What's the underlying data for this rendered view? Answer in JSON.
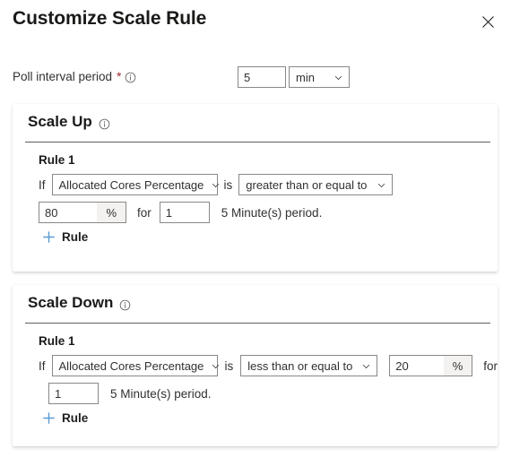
{
  "header": {
    "title": "Customize Scale Rule",
    "close_icon": "close-icon",
    "close_label": "Close"
  },
  "poll_interval": {
    "label": "Poll interval period",
    "required_marker": "*",
    "info_icon": "info-icon",
    "value": "5",
    "unit": "min",
    "unit_chevron_icon": "chevron-down-icon"
  },
  "sections": [
    {
      "id": "scale-up",
      "title": "Scale Up",
      "info_icon": "info-icon",
      "rule_label": "Rule 1",
      "if_word": "If",
      "metric": "Allocated Cores Percentage",
      "is_word": "is",
      "operator": "greater than or equal to",
      "threshold": "80",
      "threshold_unit": "%",
      "for_word": "for",
      "duration_count": "1",
      "duration_tail": "5 Minute(s) period.",
      "add_rule_label": "Rule",
      "add_rule_icon": "plus-icon"
    },
    {
      "id": "scale-down",
      "title": "Scale Down",
      "info_icon": "info-icon",
      "rule_label": "Rule 1",
      "if_word": "If",
      "metric": "Allocated Cores Percentage",
      "is_word": "is",
      "operator": "less than or equal to",
      "threshold": "20",
      "threshold_unit": "%",
      "for_word": "for",
      "duration_count": "1",
      "duration_tail": "5 Minute(s) period.",
      "add_rule_label": "Rule",
      "add_rule_icon": "plus-icon"
    }
  ],
  "colors": {
    "accent": "#0078d4",
    "plus_blue": "#5b9bd5",
    "required_red": "#a4262c",
    "border": "#8a8886",
    "adornment_bg": "#f3f2f1",
    "separator": "#605e5c",
    "text": "#323130",
    "heading": "#1b1a19"
  }
}
